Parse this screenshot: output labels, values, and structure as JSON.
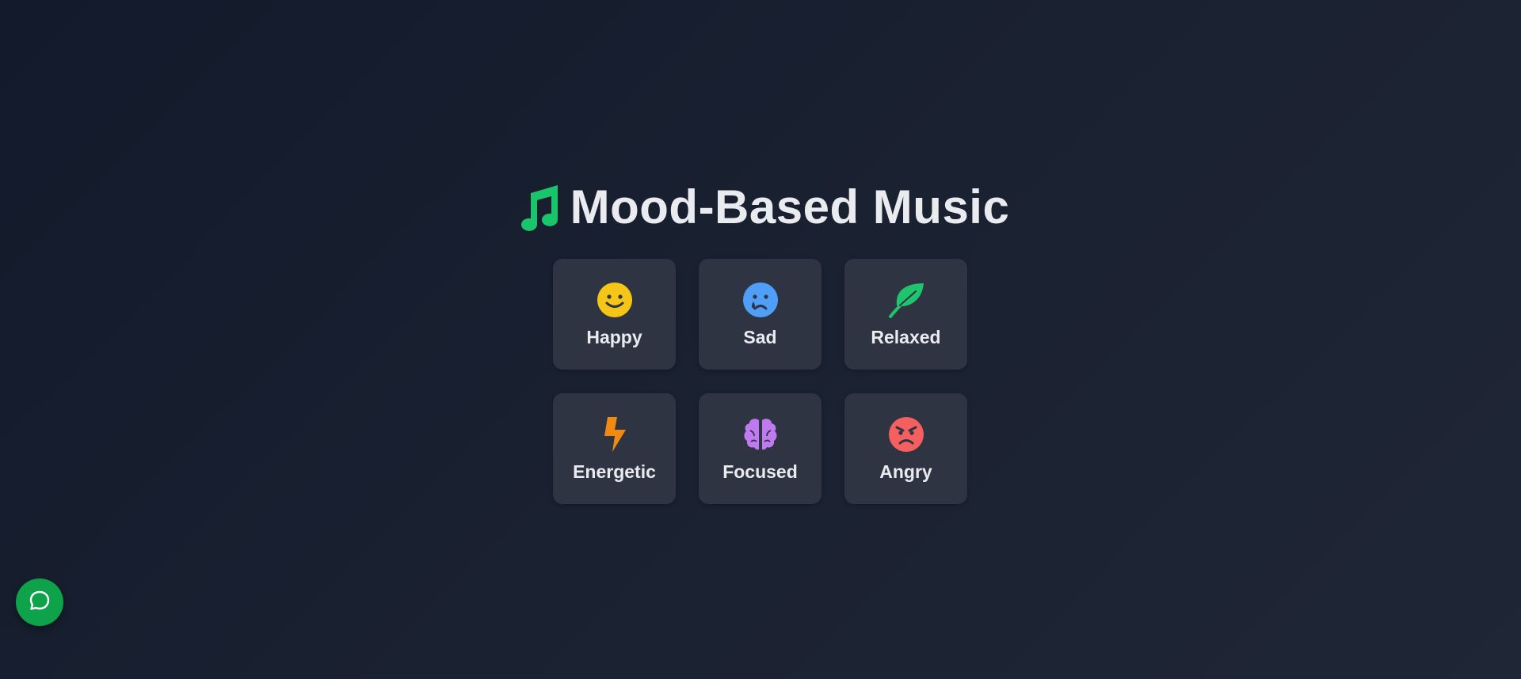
{
  "header": {
    "title": "Mood-Based Music",
    "icon": "music-note-icon",
    "icon_color": "#19c46a"
  },
  "moods": [
    {
      "label": "Happy",
      "icon": "smile-icon",
      "color": "#f5c518"
    },
    {
      "label": "Sad",
      "icon": "sad-tear-icon",
      "color": "#4f9ef8"
    },
    {
      "label": "Relaxed",
      "icon": "leaf-icon",
      "color": "#1fc46c"
    },
    {
      "label": "Energetic",
      "icon": "bolt-icon",
      "color": "#f08a12"
    },
    {
      "label": "Focused",
      "icon": "brain-icon",
      "color": "#c07af0"
    },
    {
      "label": "Angry",
      "icon": "angry-face-icon",
      "color": "#f45f5f"
    }
  ],
  "chat": {
    "icon": "chat-bubble-icon",
    "color": "#0ea24a"
  },
  "colors": {
    "background": "#171e2d",
    "card": "#2e3442",
    "text": "#e9ebef"
  }
}
